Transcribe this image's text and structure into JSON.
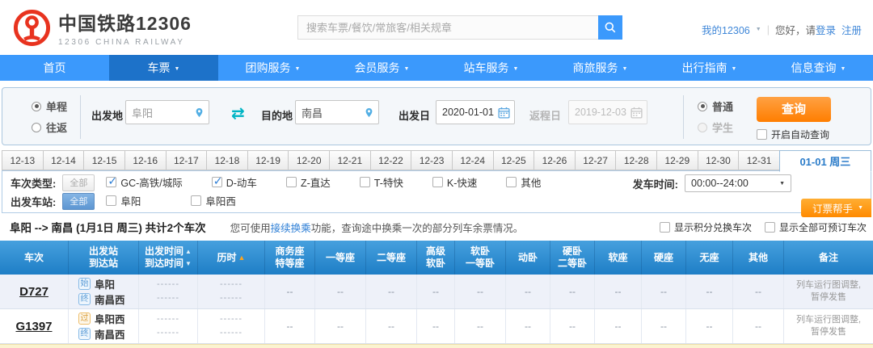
{
  "header": {
    "title": "中国铁路12306",
    "subtitle": "12306 CHINA RAILWAY",
    "search_placeholder": "搜索车票/餐饮/常旅客/相关规章",
    "my": "我的12306",
    "greeting": "您好，请",
    "login": "登录",
    "register": "注册"
  },
  "nav": {
    "items": [
      {
        "label": "首页",
        "arrow": false,
        "active": false
      },
      {
        "label": "车票",
        "arrow": true,
        "active": true
      },
      {
        "label": "团购服务",
        "arrow": true,
        "active": false
      },
      {
        "label": "会员服务",
        "arrow": true,
        "active": false
      },
      {
        "label": "站车服务",
        "arrow": true,
        "active": false
      },
      {
        "label": "商旅服务",
        "arrow": true,
        "active": false
      },
      {
        "label": "出行指南",
        "arrow": true,
        "active": false
      },
      {
        "label": "信息查询",
        "arrow": true,
        "active": false
      }
    ]
  },
  "form": {
    "one_way": "单程",
    "round_trip": "往返",
    "from_label": "出发地",
    "from_value": "阜阳",
    "to_label": "目的地",
    "to_value": "南昌",
    "depart_label": "出发日",
    "depart_value": "2020-01-01",
    "return_label": "返程日",
    "return_value": "2019-12-03",
    "normal": "普通",
    "student": "学生",
    "query_button": "查询",
    "auto_query": "开启自动查询"
  },
  "date_tabs": {
    "dates": [
      "12-13",
      "12-14",
      "12-15",
      "12-16",
      "12-17",
      "12-18",
      "12-19",
      "12-20",
      "12-21",
      "12-22",
      "12-23",
      "12-24",
      "12-25",
      "12-26",
      "12-27",
      "12-28",
      "12-29",
      "12-30",
      "12-31"
    ],
    "selected": "01-01 周三"
  },
  "filters": {
    "train_type_label": "车次类型:",
    "all_label": "全部",
    "train_types": [
      {
        "label": "GC-高铁/城际",
        "checked": true
      },
      {
        "label": "D-动车",
        "checked": true
      },
      {
        "label": "Z-直达",
        "checked": false
      },
      {
        "label": "T-特快",
        "checked": false
      },
      {
        "label": "K-快速",
        "checked": false
      },
      {
        "label": "其他",
        "checked": false
      }
    ],
    "depart_time_label": "发车时间:",
    "depart_time_value": "00:00--24:00",
    "station_label": "出发车站:",
    "stations": [
      {
        "label": "阜阳",
        "checked": false
      },
      {
        "label": "阜阳西",
        "checked": false
      }
    ],
    "helper_label": "订票帮手"
  },
  "results": {
    "summary": "阜阳 --> 南昌 (1月1日 周三) 共计2个车次",
    "notice_prefix": "您可使用",
    "notice_link": "接续换乘",
    "notice_suffix": "功能，查询途中换乘一次的部分列车余票情况。",
    "toggles": [
      "显示积分兑换车次",
      "显示全部可预订车次"
    ]
  },
  "table": {
    "columns": [
      {
        "label1": "车次"
      },
      {
        "label1": "出发站",
        "label2": "到达站"
      },
      {
        "label1": "出发时间",
        "sort1": "▲",
        "label2": "到达时间",
        "sort2": "▼"
      },
      {
        "label1": "历时",
        "sort1": "▲",
        "orange": true
      },
      {
        "label1": "商务座",
        "label2": "特等座"
      },
      {
        "label1": "一等座"
      },
      {
        "label1": "二等座"
      },
      {
        "label1": "高级",
        "label2": "软卧"
      },
      {
        "label1": "软卧",
        "label2": "一等卧"
      },
      {
        "label1": "动卧"
      },
      {
        "label1": "硬卧",
        "label2": "二等卧"
      },
      {
        "label1": "软座"
      },
      {
        "label1": "硬座"
      },
      {
        "label1": "无座"
      },
      {
        "label1": "其他"
      },
      {
        "label1": "备注"
      }
    ],
    "rows": [
      {
        "train": "D727",
        "stations": [
          {
            "type": "start",
            "tag": "始",
            "name": "阜阳"
          },
          {
            "type": "end",
            "tag": "终",
            "name": "南昌西"
          }
        ],
        "times": [
          "------",
          "------"
        ],
        "durations": [
          "------",
          "------"
        ],
        "seats": [
          "--",
          "--",
          "--",
          "--",
          "--",
          "--",
          "--",
          "--",
          "--",
          "--",
          "--"
        ],
        "remark": "列车运行图调整,暂停发售"
      },
      {
        "train": "G1397",
        "stations": [
          {
            "type": "pass",
            "tag": "过",
            "name": "阜阳西"
          },
          {
            "type": "end",
            "tag": "终",
            "name": "南昌西"
          }
        ],
        "times": [
          "------",
          "------"
        ],
        "durations": [
          "------",
          "------"
        ],
        "seats": [
          "--",
          "--",
          "--",
          "--",
          "--",
          "--",
          "--",
          "--",
          "--",
          "--",
          "--"
        ],
        "remark": "列车运行图调整,暂停发售"
      }
    ]
  }
}
